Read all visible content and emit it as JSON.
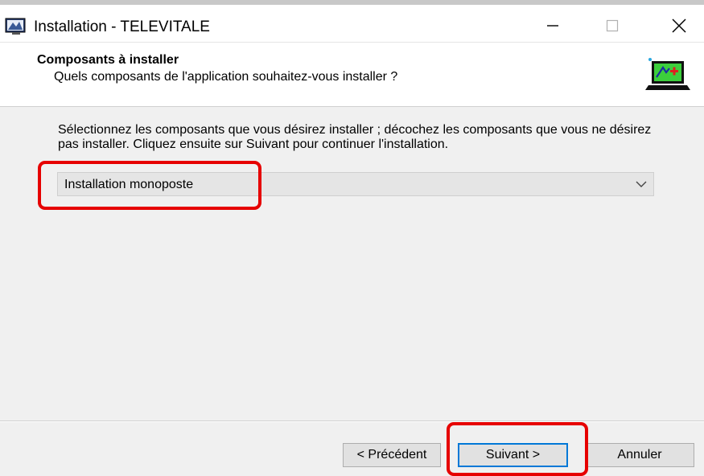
{
  "window": {
    "title": "Installation - TELEVITALE",
    "controls": {
      "minimize": "—",
      "maximize": "☐",
      "close": "✕"
    }
  },
  "header": {
    "title": "Composants à installer",
    "subtitle": "Quels composants de l'application souhaitez-vous installer ?",
    "icon": "installer-computer-icon"
  },
  "body": {
    "description": "Sélectionnez les composants que vous désirez installer ; décochez les composants que vous ne désirez pas installer. Cliquez ensuite sur Suivant pour continuer l'installation.",
    "setup_type": {
      "selected": "Installation monoposte"
    }
  },
  "buttons": {
    "previous": "< Précédent",
    "next": "Suivant >",
    "cancel": "Annuler"
  },
  "colors": {
    "highlight": "#e60000",
    "focus_border": "#0078d7",
    "background": "#f0f0f0"
  }
}
